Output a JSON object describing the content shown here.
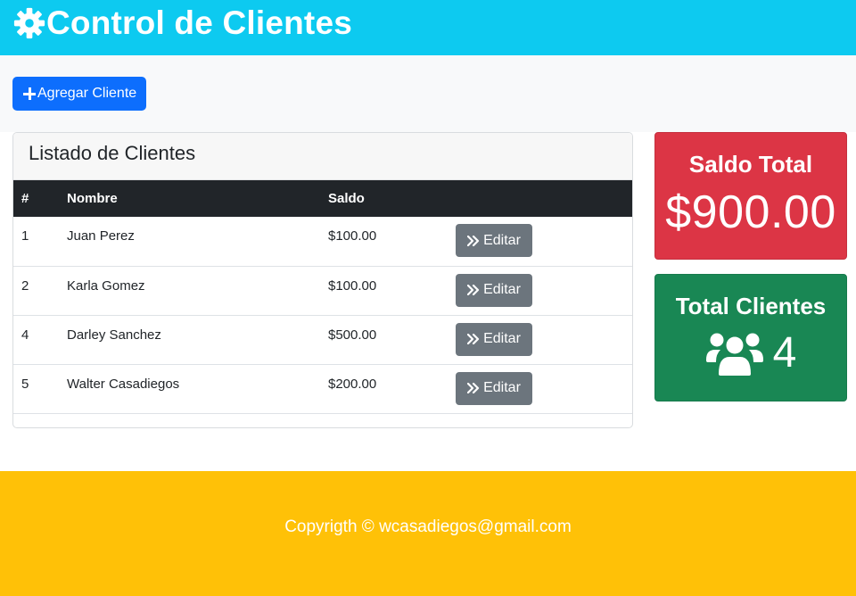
{
  "header": {
    "title": "Control de Clientes",
    "icon": "gear-icon",
    "bg_color": "#0dcaf0"
  },
  "actions": {
    "add_label": "Agregar Cliente",
    "add_icon": "plus-icon",
    "add_color": "#0d6efd"
  },
  "listado": {
    "title": "Listado de Clientes",
    "columns": [
      "#",
      "Nombre",
      "Saldo",
      ""
    ],
    "edit_label": "Editar",
    "edit_icon": "angles-right-icon",
    "rows": [
      {
        "id": "1",
        "nombre": "Juan Perez",
        "saldo": "$100.00"
      },
      {
        "id": "2",
        "nombre": "Karla Gomez",
        "saldo": "$100.00"
      },
      {
        "id": "4",
        "nombre": "Darley Sanchez",
        "saldo": "$500.00"
      },
      {
        "id": "5",
        "nombre": "Walter Casadiegos",
        "saldo": "$200.00"
      }
    ]
  },
  "saldo_total": {
    "title": "Saldo Total",
    "value": "$900.00",
    "color": "#dc3545"
  },
  "total_clientes": {
    "title": "Total Clientes",
    "value": "4",
    "icon": "users-icon",
    "color": "#198754"
  },
  "footer": {
    "text": "Copyrigth © wcasadiegos@gmail.com",
    "bg_color": "#ffc107"
  }
}
